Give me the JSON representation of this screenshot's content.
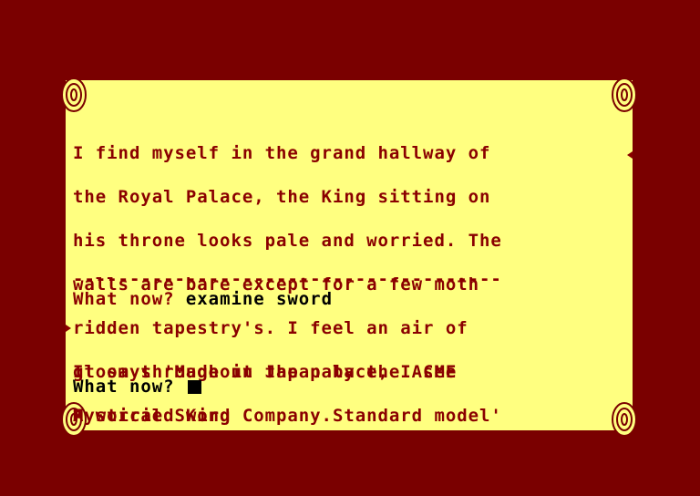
{
  "location_description": [
    "I find myself in the grand hallway of",
    "the Royal Palace, the King sitting on",
    "his throne looks pale and worried. The",
    "walls are bare except for a few moth",
    "ridden tapestry's. I feel an air of",
    "gloom throughout the palace, I see",
    "A worried King"
  ],
  "separator": "--------------------------------------",
  "first_prompt": "What now?",
  "first_command": "examine sword",
  "response": [
    "It says 'Made in Japan by the ACME",
    "Mystical Sword Company.Standard model'"
  ],
  "second_prompt": "What now?",
  "colors": {
    "background": "#7a0000",
    "parchment": "#ffff80",
    "text": "#8a0000",
    "input_text": "#000000"
  }
}
